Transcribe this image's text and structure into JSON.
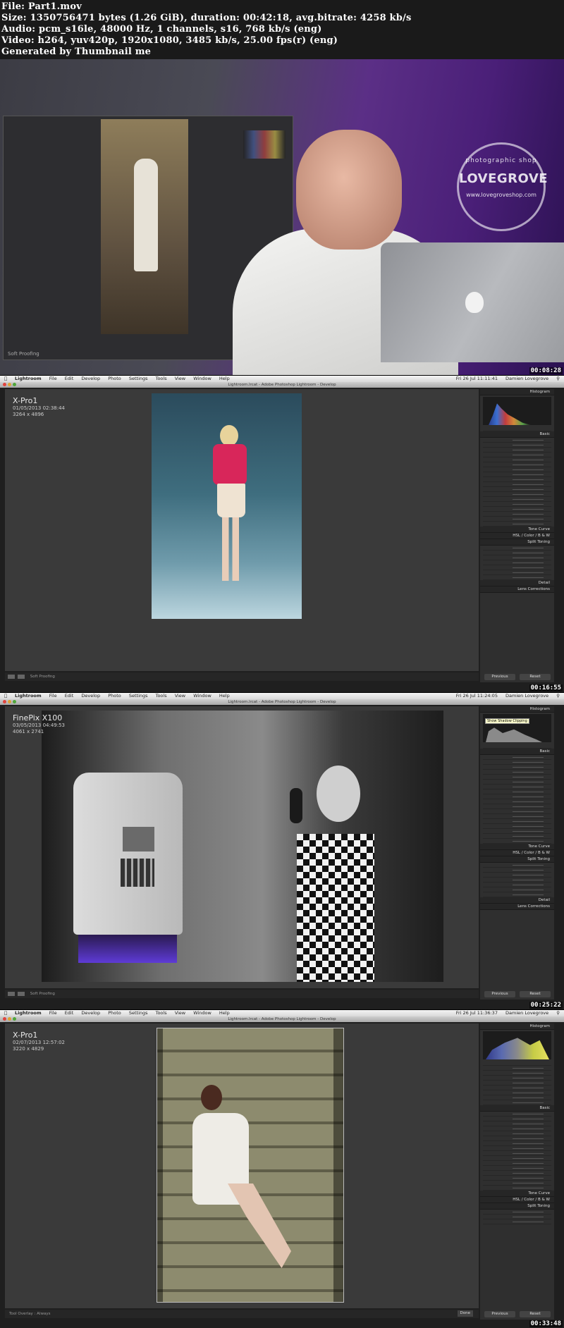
{
  "header": {
    "file_line": "File: Part1.mov",
    "size_line": "Size: 1350756471 bytes (1.26 GiB), duration: 00:42:18, avg.bitrate: 4258 kb/s",
    "audio_line": "Audio: pcm_s16le, 48000 Hz, 1 channels, s16, 768 kb/s (eng)",
    "video_line": "Video: h264, yuv420p, 1920x1080, 3485 kb/s, 25.00 fps(r) (eng)",
    "generator_line": "Generated by Thumbnail me"
  },
  "frame1": {
    "timestamp": "00:08:28",
    "logo": {
      "top_text": "photographic shop",
      "brand": "LOVEGROVE",
      "url": "www.lovegroveshop.com"
    },
    "monitor_status": "Soft Proofing"
  },
  "menu": {
    "app": "Lightroom",
    "items": [
      "File",
      "Edit",
      "Develop",
      "Photo",
      "Settings",
      "Tools",
      "View",
      "Window",
      "Help"
    ],
    "user": "Damien Lovegrove"
  },
  "window_title": "Lightroom.lrcat - Adobe Photoshop Lightroom - Develop",
  "frames": [
    {
      "timestamp": "00:16:55",
      "clock": "Fri 26 Jul  11:11:41",
      "camera": "X-Pro1",
      "date": "01/05/2013 02:38:44",
      "dims": "3264 x 4896",
      "filmstrip_label": "Soft Proofing",
      "panels": [
        "Histogram",
        "Basic",
        "Tone Curve",
        "HSL / Color / B & W",
        "Split Toning",
        "Detail",
        "Lens Corrections"
      ],
      "buttons": [
        "Previous",
        "Reset"
      ]
    },
    {
      "timestamp": "00:25:22",
      "clock": "Fri 26 Jul  11:24:05",
      "camera": "FinePix X100",
      "date": "03/05/2013 04:49:53",
      "dims": "4061 x 2741",
      "filmstrip_label": "Soft Proofing",
      "tooltip": "Show Shadow Clipping",
      "panels": [
        "Histogram",
        "Basic",
        "Tone Curve",
        "HSL / Color / B & W",
        "Split Toning",
        "Detail",
        "Lens Corrections"
      ],
      "buttons": [
        "Previous",
        "Reset"
      ]
    },
    {
      "timestamp": "00:33:48",
      "clock": "Fri 26 Jul  11:36:37",
      "camera": "X-Pro1",
      "date": "02/07/2013 12:57:02",
      "dims": "3220 x 4829",
      "filmstrip_label": "Tool Overlay :  Always",
      "done_label": "Done",
      "panels": [
        "Histogram",
        "Basic",
        "Tone Curve",
        "HSL / Color / B & W",
        "Split Toning"
      ],
      "buttons": [
        "Previous",
        "Reset"
      ]
    }
  ],
  "colors": {
    "studio_purple": "#5b2f86",
    "lightroom_panel": "#2f2f2f",
    "lightroom_work": "#3a3a3a",
    "jacket_pink": "#d8265a"
  }
}
